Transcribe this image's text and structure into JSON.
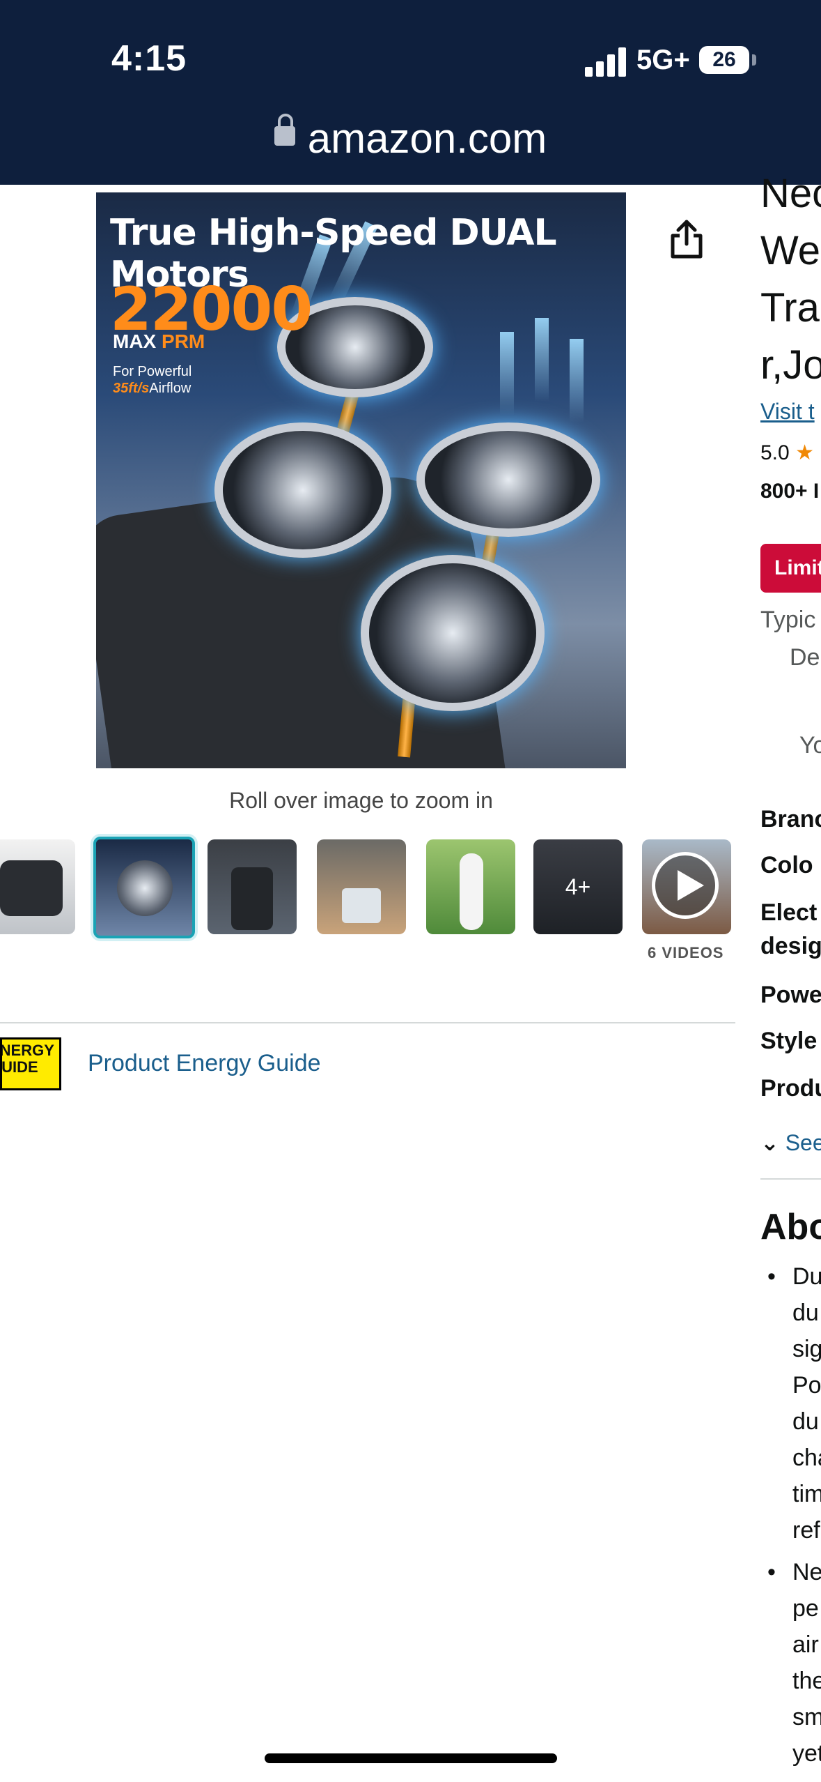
{
  "status_bar": {
    "time": "4:15",
    "network": "5G+",
    "battery": "26"
  },
  "browser": {
    "url": "amazon.com"
  },
  "product_image": {
    "headline": "True High-Speed DUAL Motors",
    "rpm_value": "22000",
    "rpm_label_max": "MAX",
    "rpm_label_unit": "PRM",
    "airflow_prefix": "For Powerful",
    "airflow_value": "35ft/s",
    "airflow_suffix": "Airflow"
  },
  "zoom_hint": "Roll over image to zoom in",
  "thumbnails": {
    "more_label": "4+",
    "videos_label": "6 VIDEOS"
  },
  "energy_guide": {
    "badge_text": "ENERGY GUIDE",
    "link": "Product Energy Guide"
  },
  "right_panel": {
    "title_lines": [
      "Nec",
      "We",
      "Tra",
      "r,Jo"
    ],
    "visit_store": "Visit t",
    "rating": "5.0",
    "bought": "800+ I",
    "deal_badge": "Limit",
    "typical": "Typic",
    "delivery": "De",
    "you": "Yo",
    "spec_labels": [
      "Branc",
      "Colo",
      "Elect",
      "desig",
      "Powe",
      "Style",
      "Produ"
    ],
    "see_more": "See",
    "about_heading": "Abo",
    "bullet1_lines": [
      "Du",
      "du",
      "sig",
      "Po",
      "du",
      "cha",
      "tim",
      "ref"
    ],
    "bullet2_lines": [
      "Ne",
      "pe",
      "air",
      "the",
      "sm",
      "yet"
    ]
  }
}
